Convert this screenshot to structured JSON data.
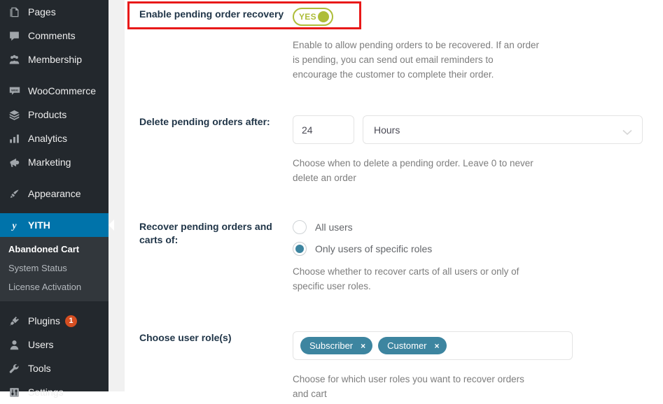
{
  "sidebar": {
    "items": [
      {
        "label": "Pages",
        "icon": "pages-icon",
        "separator": false
      },
      {
        "label": "Comments",
        "icon": "comments-icon",
        "separator": false
      },
      {
        "label": "Membership",
        "icon": "membership-icon",
        "separator": false
      },
      {
        "label": "WooCommerce",
        "icon": "woocommerce-icon",
        "separator": true
      },
      {
        "label": "Products",
        "icon": "products-icon",
        "separator": false
      },
      {
        "label": "Analytics",
        "icon": "analytics-icon",
        "separator": false
      },
      {
        "label": "Marketing",
        "icon": "marketing-icon",
        "separator": false
      },
      {
        "label": "Appearance",
        "icon": "appearance-icon",
        "separator": true
      }
    ],
    "current": {
      "label": "YITH",
      "icon": "yith-icon"
    },
    "submenu": [
      {
        "label": "Abandoned Cart",
        "active": true
      },
      {
        "label": "System Status",
        "active": false
      },
      {
        "label": "License Activation",
        "active": false
      }
    ],
    "bottom_items": [
      {
        "label": "Plugins",
        "icon": "plugins-icon",
        "badge": "1",
        "separator": true
      },
      {
        "label": "Users",
        "icon": "users-icon",
        "badge": "",
        "separator": false
      },
      {
        "label": "Tools",
        "icon": "tools-icon",
        "badge": "",
        "separator": false
      },
      {
        "label": "Settings",
        "icon": "settings-icon",
        "badge": "",
        "separator": false
      }
    ]
  },
  "settings": {
    "enable_recovery": {
      "label": "Enable pending order recovery",
      "toggle_text": "YES",
      "toggle_state": "on",
      "description": "Enable to allow pending orders to be recovered. If an order is pending, you can send out email reminders to encourage the customer to complete their order."
    },
    "delete_after": {
      "label": "Delete pending orders after:",
      "value": "24",
      "unit": "Hours",
      "description": "Choose when to delete a pending order. Leave 0 to never delete an order"
    },
    "recover_for": {
      "label": "Recover pending orders and carts of:",
      "options": [
        {
          "label": "All users",
          "selected": false
        },
        {
          "label": "Only users of specific roles",
          "selected": true
        }
      ],
      "description": "Choose whether to recover carts of all users or only of specific user roles."
    },
    "user_roles": {
      "label": "Choose user role(s)",
      "tags": [
        "Subscriber",
        "Customer"
      ],
      "remove_label": "×",
      "description": "Choose for which user roles you want to recover orders and cart"
    }
  },
  "colors": {
    "sidebar_bg": "#23282d",
    "submenu_bg": "#32373c",
    "accent_blue": "#0073aa",
    "toggle_green": "#aebd39",
    "tag_teal": "#3d85a0",
    "badge_orange": "#d54e21",
    "highlight_red": "#e81919"
  }
}
